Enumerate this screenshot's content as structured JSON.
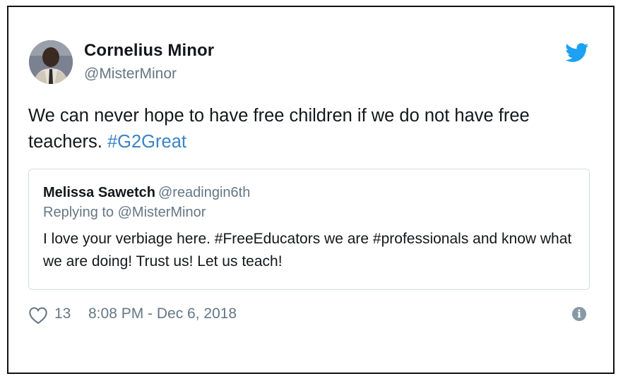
{
  "tweet": {
    "author_name": "Cornelius Minor",
    "author_handle": "@MisterMinor",
    "text_plain": "We can never hope to have free children if we do not have free teachers. ",
    "hashtag": "#G2Great",
    "likes": "13",
    "timestamp": "8:08 PM - Dec 6, 2018"
  },
  "quoted": {
    "author_name": "Melissa Sawetch",
    "author_handle": "@readingin6th",
    "replying_to": "Replying to @MisterMinor",
    "text": "I love your verbiage here. #FreeEducators we are #professionals and know what we are doing! Trust us! Let us teach!"
  },
  "icons": {
    "brand": "twitter-bird-icon",
    "like": "heart-icon",
    "info": "info-icon"
  },
  "colors": {
    "twitter_blue": "#1da1f2",
    "hashtag": "#3b84c6",
    "secondary_text": "#657786"
  }
}
